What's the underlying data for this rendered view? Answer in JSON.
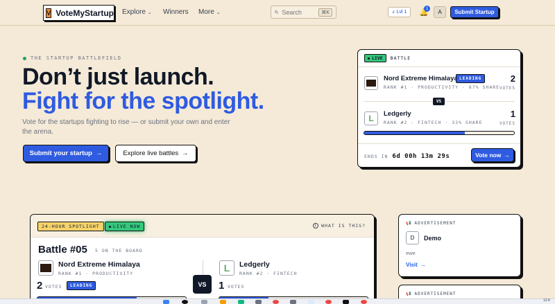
{
  "header": {
    "logo_letter": "V",
    "brand": "VoteMyStartup",
    "nav": [
      {
        "label": "Explore",
        "has_chevron": true
      },
      {
        "label": "Winners",
        "has_chevron": false
      },
      {
        "label": "More",
        "has_chevron": true
      }
    ],
    "search_placeholder": "Search",
    "search_shortcut": "⌘K",
    "level_label": "Lvl 1",
    "notification_count": "1",
    "avatar_initial": "A",
    "submit_label": "Submit Startup"
  },
  "hero": {
    "eyebrow": "THE STARTUP BATTLEFIELD",
    "headline_line1": "Don’t just launch.",
    "headline_line2": "Fight for the spotlight.",
    "subtext": "Vote for the startups fighting to rise — or submit your own and enter the arena.",
    "primary_cta": "Submit your startup",
    "secondary_cta": "Explore live battles"
  },
  "battle_card": {
    "live_label": "LIVE",
    "title": "BATTLE",
    "contenders": [
      {
        "name": "Nord Extreme Himalaya",
        "badge": "LEADING",
        "meta": "RANK #1 · PRODUCTIVITY · 67% SHARE",
        "votes": "2",
        "votes_label": "VOTES"
      },
      {
        "name": "Ledgerly",
        "badge": "",
        "meta": "RANK #2 · FINTECH · 33% SHARE",
        "votes": "1",
        "votes_label": "VOTES"
      }
    ],
    "vs_label": "VS",
    "leader_share": 0.67,
    "ends_label": "ENDS IN",
    "countdown": "6d 00h 13m 29s",
    "vote_button": "Vote now"
  },
  "spotlight": {
    "tag_24h": "24-HOUR SPOTLIGHT",
    "tag_live": "LIVE NOW",
    "what_label": "WHAT IS THIS?",
    "battle_title": "Battle #05",
    "battle_subtitle": "5 ON THE BOARD",
    "vs_label": "VS",
    "left": {
      "name": "Nord Extreme Himalaya",
      "meta": "RANK #1 · PRODUCTIVITY",
      "votes": "2",
      "votes_label": "VOTES",
      "badge": "LEADING",
      "share": 0.67
    },
    "right": {
      "name": "Ledgerly",
      "meta": "RANK #2 · FINTECH",
      "votes": "1",
      "votes_label": "VOTES",
      "share": 0.33
    }
  },
  "ads": [
    {
      "label": "ADVERTISEMENT",
      "logo_letter": "D",
      "name": "Demo",
      "description": "ewe",
      "link": "Visit"
    },
    {
      "label": "ADVERTISEMENT"
    }
  ],
  "taskbar": {
    "time": "12:0"
  },
  "colors": {
    "accent": "#2f5be0",
    "background": "#f5ead8",
    "live": "#34c77b",
    "spotlight_tag": "#f6d36b"
  }
}
